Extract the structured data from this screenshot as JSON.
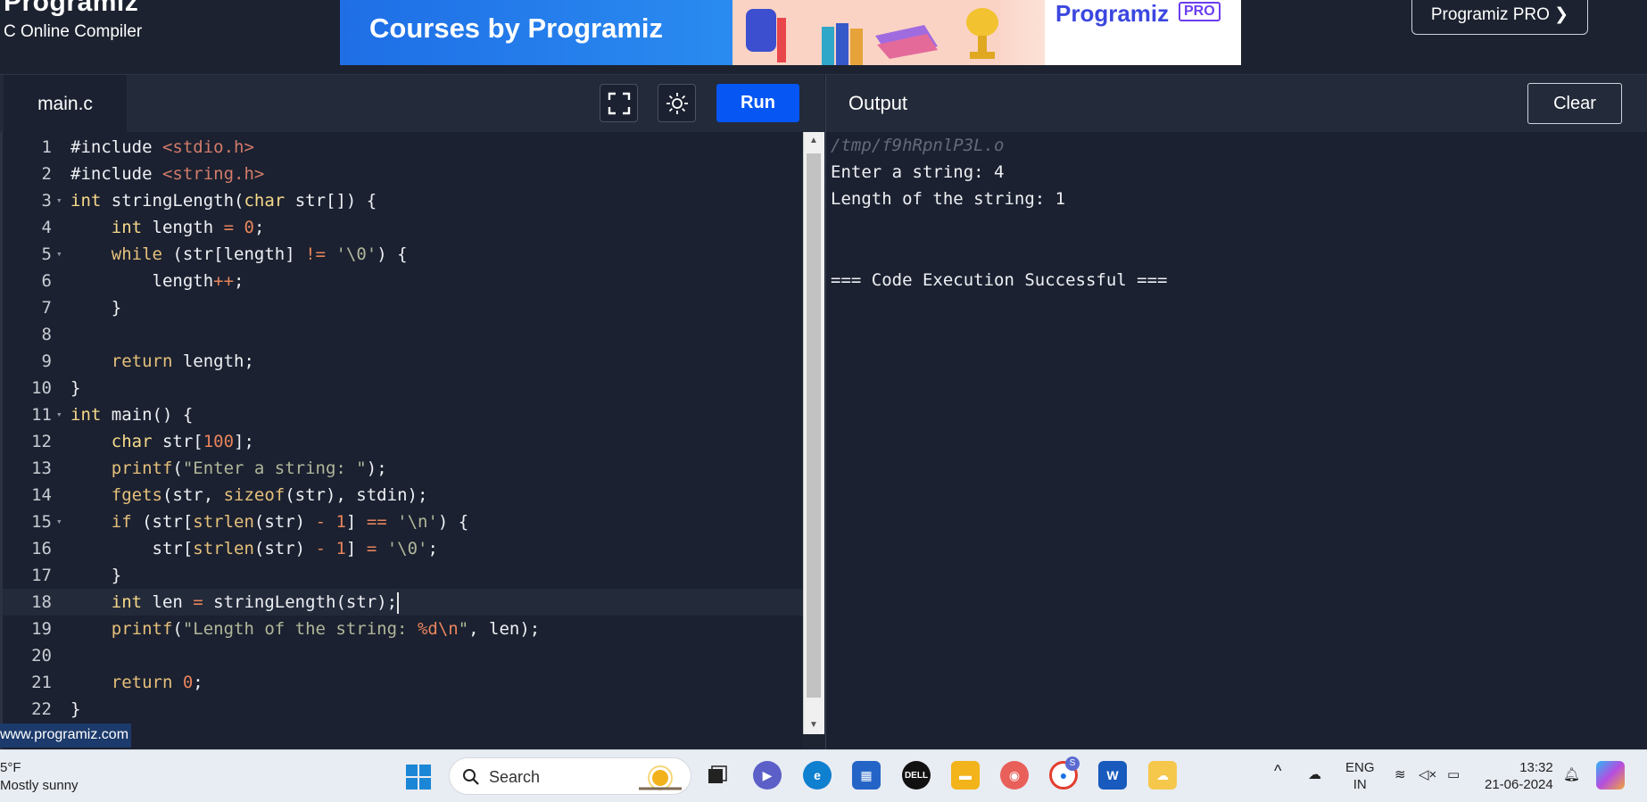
{
  "header": {
    "brand": "Programiz",
    "subtitle": "C Online Compiler",
    "banner_text": "Courses by Programiz",
    "banner_logo": "Programiz",
    "banner_logo_badge": "PRO",
    "pro_button": "Programiz PRO ❯"
  },
  "editor": {
    "tab": "main.c",
    "run_label": "Run",
    "lines": [
      {
        "n": "1"
      },
      {
        "n": "2"
      },
      {
        "n": "3"
      },
      {
        "n": "4"
      },
      {
        "n": "5"
      },
      {
        "n": "6"
      },
      {
        "n": "7"
      },
      {
        "n": "8"
      },
      {
        "n": "9"
      },
      {
        "n": "10"
      },
      {
        "n": "11"
      },
      {
        "n": "12"
      },
      {
        "n": "13"
      },
      {
        "n": "14"
      },
      {
        "n": "15"
      },
      {
        "n": "16"
      },
      {
        "n": "17"
      },
      {
        "n": "18"
      },
      {
        "n": "19"
      },
      {
        "n": "20"
      },
      {
        "n": "21"
      },
      {
        "n": "22"
      }
    ],
    "code": {
      "l1a": "#include ",
      "l1b": "<stdio.h>",
      "l2a": "#include ",
      "l2b": "<string.h>",
      "l3a": "int",
      "l3b": " stringLength(",
      "l3c": "char",
      "l3d": " str[]) {",
      "l4a": "    int",
      "l4b": " length ",
      "l4c": "=",
      "l4d": " ",
      "l4e": "0",
      "l4f": ";",
      "l5a": "    while",
      "l5b": " (str[length] ",
      "l5c": "!=",
      "l5d": " ",
      "l5e": "'\\0'",
      "l5f": ") {",
      "l6a": "        length",
      "l6b": "++",
      "l6c": ";",
      "l7": "    }",
      "l9a": "    return",
      "l9b": " length;",
      "l10": "}",
      "l11a": "int",
      "l11b": " main() {",
      "l12a": "    char",
      "l12b": " str[",
      "l12c": "100",
      "l12d": "];",
      "l13a": "    printf",
      "l13b": "(",
      "l13c": "\"Enter a string: \"",
      "l13d": ");",
      "l14a": "    fgets",
      "l14b": "(str, ",
      "l14c": "sizeof",
      "l14d": "(str), stdin);",
      "l15a": "    if",
      "l15b": " (str[",
      "l15c": "strlen",
      "l15d": "(str) ",
      "l15e": "-",
      "l15f": " ",
      "l15g": "1",
      "l15h": "] ",
      "l15i": "==",
      "l15j": " ",
      "l15k": "'\\n'",
      "l15l": ") {",
      "l16a": "        str[",
      "l16b": "strlen",
      "l16c": "(str) ",
      "l16d": "-",
      "l16e": " ",
      "l16f": "1",
      "l16g": "] ",
      "l16h": "=",
      "l16i": " ",
      "l16j": "'\\0'",
      "l16k": ";",
      "l17": "    }",
      "l18a": "    int",
      "l18b": " len ",
      "l18c": "=",
      "l18d": " stringLength(str);",
      "l19a": "    printf",
      "l19b": "(",
      "l19c": "\"Length of the string: ",
      "l19d": "%d\\n",
      "l19e": "\"",
      "l19f": ", len);",
      "l21a": "    return",
      "l21b": " ",
      "l21c": "0",
      "l21d": ";",
      "l22": "}"
    }
  },
  "output": {
    "title": "Output",
    "clear_label": "Clear",
    "lines": [
      "/tmp/f9hRpnlP3L.o",
      "Enter a string: 4",
      "Length of the string: 1",
      "=== Code Execution Successful ==="
    ]
  },
  "status_url": "www.programiz.com",
  "taskbar": {
    "weather_temp": "5°F",
    "weather_desc": "Mostly sunny",
    "search_placeholder": "Search",
    "lang_top": "ENG",
    "lang_bottom": "IN",
    "time": "13:32",
    "date": "21-06-2024",
    "chrome_badge": "S"
  },
  "colors": {
    "run_button": "#0556f3",
    "editor_bg": "#1b2130",
    "header_bg": "#232a39"
  }
}
